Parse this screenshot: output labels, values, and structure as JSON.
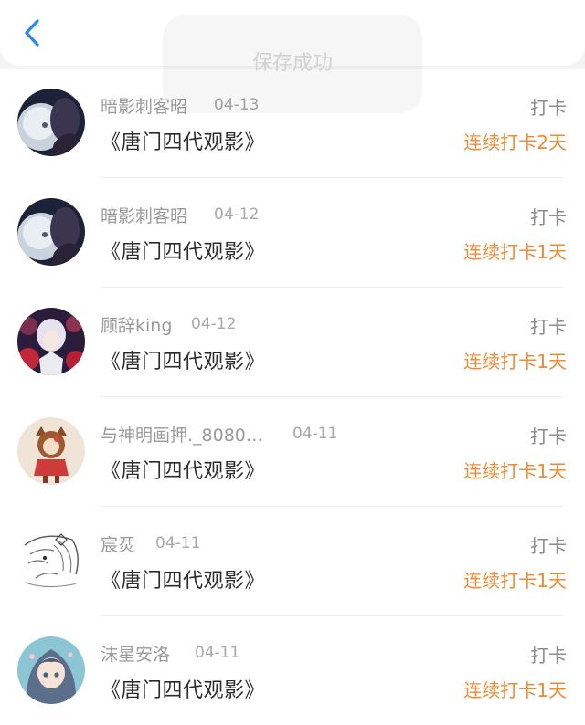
{
  "header": {
    "back_icon": "chevron-left-icon",
    "accent_color": "#2e8ae6"
  },
  "toast": {
    "text": "保存成功"
  },
  "feed": {
    "items": [
      {
        "user": "暗影刺客昭",
        "date": "04-13",
        "title": "《唐门四代观影》",
        "action": "打卡",
        "streak": "连续打卡2天"
      },
      {
        "user": "暗影刺客昭",
        "date": "04-12",
        "title": "《唐门四代观影》",
        "action": "打卡",
        "streak": "连续打卡1天"
      },
      {
        "user": "顾辞king",
        "date": "04-12",
        "title": "《唐门四代观影》",
        "action": "打卡",
        "streak": "连续打卡1天"
      },
      {
        "user": "与神明画押._8080…",
        "date": "04-11",
        "title": "《唐门四代观影》",
        "action": "打卡",
        "streak": "连续打卡1天"
      },
      {
        "user": "宸烎",
        "date": "04-11",
        "title": "《唐门四代观影》",
        "action": "打卡",
        "streak": "连续打卡1天"
      },
      {
        "user": "沫星安洛",
        "date": "04-11",
        "title": "《唐门四代观影》",
        "action": "打卡",
        "streak": "连续打卡1天"
      }
    ]
  },
  "colors": {
    "streak": "#f08a33",
    "name": "#9a9a9a",
    "title": "#2c2c2c"
  }
}
